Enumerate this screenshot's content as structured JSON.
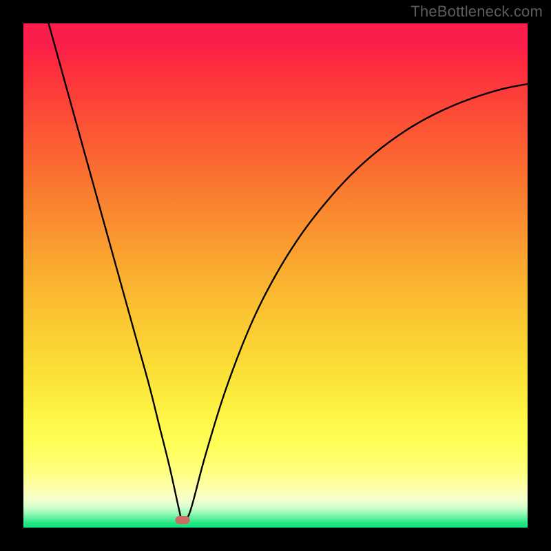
{
  "watermark": "TheBottleneck.com",
  "chart_data": {
    "type": "line",
    "title": "",
    "xlabel": "",
    "ylabel": "",
    "xlim": [
      0,
      100
    ],
    "ylim": [
      0,
      100
    ],
    "series": [
      {
        "name": "curve",
        "x": [
          5,
          7.5,
          10,
          12.5,
          15,
          17.5,
          20,
          22.5,
          25,
          27,
          29,
          31,
          31.5,
          33,
          36,
          40,
          45,
          50,
          55,
          60,
          65,
          70,
          75,
          80,
          85,
          90,
          95,
          100
        ],
        "y": [
          100,
          91,
          82,
          73,
          64,
          55,
          46,
          37,
          28,
          20,
          12,
          3,
          1.5,
          3,
          14,
          27,
          40,
          50,
          58,
          64.5,
          70,
          74.5,
          78.2,
          81.2,
          83.6,
          85.5,
          87,
          88
        ]
      }
    ],
    "marker": {
      "x": 31.5,
      "y": 1.5
    },
    "background": {
      "gradient_stops": [
        {
          "pos": 0.0,
          "color": "#fb1d4a"
        },
        {
          "pos": 0.04,
          "color": "#fb1d4a"
        },
        {
          "pos": 0.08,
          "color": "#fd2a3f"
        },
        {
          "pos": 0.18,
          "color": "#fc4b36"
        },
        {
          "pos": 0.28,
          "color": "#fb6b31"
        },
        {
          "pos": 0.38,
          "color": "#fa8a2f"
        },
        {
          "pos": 0.48,
          "color": "#faa92f"
        },
        {
          "pos": 0.58,
          "color": "#fbc531"
        },
        {
          "pos": 0.68,
          "color": "#fbdd36"
        },
        {
          "pos": 0.74,
          "color": "#fcec3d"
        },
        {
          "pos": 0.79,
          "color": "#fef849"
        },
        {
          "pos": 0.84,
          "color": "#feff5b"
        },
        {
          "pos": 0.885,
          "color": "#ffff7b"
        },
        {
          "pos": 0.92,
          "color": "#fdffa9"
        },
        {
          "pos": 0.945,
          "color": "#f6ffcf"
        },
        {
          "pos": 0.96,
          "color": "#d0ffce"
        },
        {
          "pos": 0.972,
          "color": "#95f9b3"
        },
        {
          "pos": 0.984,
          "color": "#4eef96"
        },
        {
          "pos": 0.992,
          "color": "#1ee682"
        },
        {
          "pos": 1.0,
          "color": "#0fe47d"
        }
      ]
    }
  }
}
